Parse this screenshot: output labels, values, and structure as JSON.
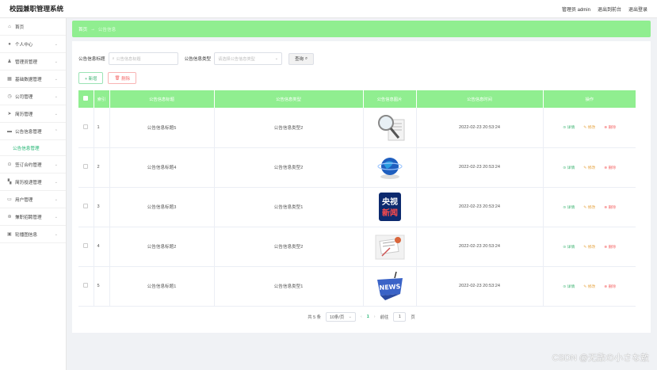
{
  "app": {
    "title": "校园兼职管理系统"
  },
  "topbar": {
    "admin": "管理员 admin",
    "back": "退出到前台",
    "logout": "退出登录"
  },
  "sidebar": {
    "items": [
      {
        "label": "首页",
        "icon": "home-icon",
        "glyph": "⌂",
        "chev": ""
      },
      {
        "label": "个人中心",
        "icon": "user-icon",
        "glyph": "●",
        "chev": "⌄"
      },
      {
        "label": "管理员管理",
        "icon": "admin-icon",
        "glyph": "♟",
        "chev": "⌄"
      },
      {
        "label": "基础数据管理",
        "icon": "data-icon",
        "glyph": "▦",
        "chev": "⌄"
      },
      {
        "label": "公司管理",
        "icon": "company-icon",
        "glyph": "◷",
        "chev": "⌄"
      },
      {
        "label": "简历管理",
        "icon": "send-icon",
        "glyph": "➤",
        "chev": "⌄"
      },
      {
        "label": "公告信息管理",
        "icon": "notice-icon",
        "glyph": "▬",
        "chev": "⌃"
      }
    ],
    "sub_item": "公告信息管理",
    "items_after": [
      {
        "label": "签订合约管理",
        "icon": "contract-icon",
        "glyph": "⊙",
        "chev": "⌄"
      },
      {
        "label": "简历投递管理",
        "icon": "grid-icon",
        "glyph": "▚",
        "chev": "⌄"
      },
      {
        "label": "用户管理",
        "icon": "users-icon",
        "glyph": "▭",
        "chev": "⌄"
      },
      {
        "label": "兼职招聘管理",
        "icon": "recruit-icon",
        "glyph": "⊛",
        "chev": "⌄"
      },
      {
        "label": "轮播图信息",
        "icon": "carousel-icon",
        "glyph": "▣",
        "chev": "⌄"
      }
    ]
  },
  "breadcrumb": {
    "home": "首页",
    "sep": "→",
    "current": "公告信息"
  },
  "search": {
    "title_label": "公告信息标题",
    "title_placeholder": "公告信息标题",
    "type_label": "公告信息类型",
    "type_placeholder": "请选择公告信息类型",
    "button": "查询"
  },
  "actions": {
    "add": "+ 新增",
    "delete": "删除"
  },
  "table": {
    "headers": [
      "",
      "索引",
      "公告信息标题",
      "公告信息类型",
      "公告信息图片",
      "公告信息时间",
      "操作"
    ],
    "rows": [
      {
        "index": "1",
        "title": "公告信息标题5",
        "type": "公告信息类型2",
        "time": "2022-02-23 20:53:24",
        "img": "magnifier"
      },
      {
        "index": "2",
        "title": "公告信息标题4",
        "type": "公告信息类型2",
        "time": "2022-02-23 20:53:24",
        "img": "globe"
      },
      {
        "index": "3",
        "title": "公告信息标题3",
        "type": "公告信息类型1",
        "time": "2022-02-23 20:53:24",
        "img": "cctv"
      },
      {
        "index": "4",
        "title": "公告信息标题2",
        "type": "公告信息类型2",
        "time": "2022-02-23 20:53:24",
        "img": "paper"
      },
      {
        "index": "5",
        "title": "公告信息标题1",
        "type": "公告信息类型1",
        "time": "2022-02-23 20:53:24",
        "img": "news"
      }
    ],
    "ops": {
      "view": "详情",
      "edit": "修改",
      "del": "删除"
    },
    "cctv_text": [
      "央视",
      "新闻"
    ],
    "news_text": "NEWS"
  },
  "pager": {
    "total": "共 5 条",
    "size": "10条/页",
    "page": "1",
    "goto_label": "前往",
    "goto_value": "1",
    "page_unit": "页"
  },
  "watermark": "CSDN @无敌の小さな敖"
}
